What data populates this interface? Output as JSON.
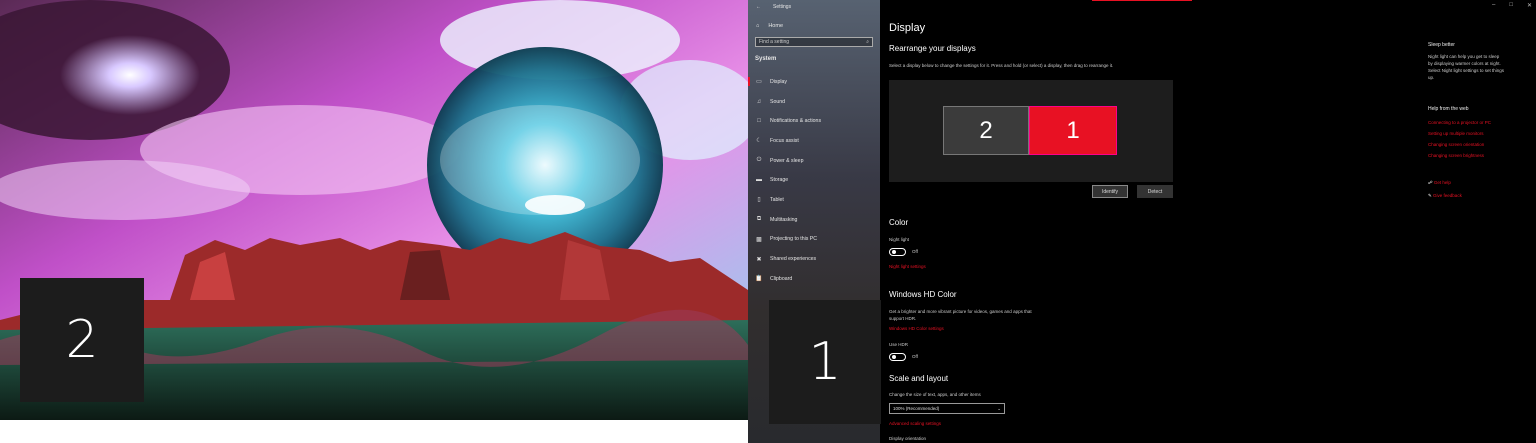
{
  "identify": {
    "left_number": "2",
    "right_number": "1"
  },
  "settings": {
    "app_title": "Settings",
    "home_label": "Home",
    "search_placeholder": "Find a setting",
    "section_title": "System",
    "nav_items": [
      {
        "label": "Display",
        "icon": "monitor-icon"
      },
      {
        "label": "Sound",
        "icon": "speaker-icon"
      },
      {
        "label": "Notifications & actions",
        "icon": "notification-icon"
      },
      {
        "label": "Focus assist",
        "icon": "moon-icon"
      },
      {
        "label": "Power & sleep",
        "icon": "power-icon"
      },
      {
        "label": "Storage",
        "icon": "storage-icon"
      },
      {
        "label": "Tablet",
        "icon": "tablet-icon"
      },
      {
        "label": "Multitasking",
        "icon": "multitasking-icon"
      },
      {
        "label": "Projecting to this PC",
        "icon": "projector-icon"
      },
      {
        "label": "Shared experiences",
        "icon": "shared-icon"
      },
      {
        "label": "Clipboard",
        "icon": "clipboard-icon"
      }
    ]
  },
  "display": {
    "title": "Display",
    "rearrange_heading": "Rearrange your displays",
    "rearrange_desc": "Select a display below to change the settings for it. Press and hold (or select) a display, then drag to rearrange it.",
    "monitor_2": "2",
    "monitor_1": "1",
    "identify_label": "Identify",
    "detect_label": "Detect",
    "color_heading": "Color",
    "night_light_label": "Night light",
    "night_light_state": "Off",
    "night_light_settings_link": "Night light settings",
    "hd_heading": "Windows HD Color",
    "hd_desc_1": "Get a brighter and more vibrant picture for videos, games and apps that",
    "hd_desc_2": "support HDR.",
    "hd_settings_link": "Windows HD Color settings",
    "hdr_label": "Use HDR",
    "hdr_state": "Off",
    "scale_heading": "Scale and layout",
    "scale_desc": "Change the size of text, apps, and other items",
    "scale_value": "100% (Recommended)",
    "advanced_scaling_link": "Advanced scaling settings",
    "orientation_label": "Display orientation"
  },
  "right_panel": {
    "sleep_heading": "Sleep better",
    "sleep_text_1": "Night light can help you get to sleep",
    "sleep_text_2": "by displaying warmer colors at night.",
    "sleep_text_3": "Select Night light settings to set things",
    "sleep_text_4": "up.",
    "help_heading": "Help from the web",
    "help_links": [
      "Connecting to a projector or PC",
      "Setting up multiple monitors",
      "Changing screen orientation",
      "Changing screen brightness"
    ],
    "get_help": "Get help",
    "give_feedback": "Give feedback"
  },
  "colors": {
    "accent": "#e81123",
    "background": "#000000"
  }
}
